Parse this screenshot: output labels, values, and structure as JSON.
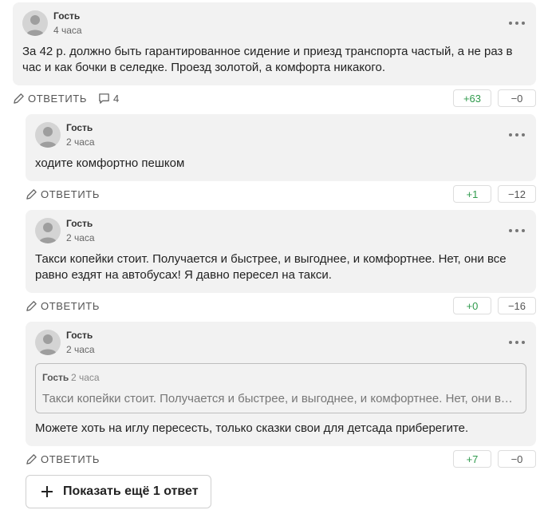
{
  "comments": [
    {
      "author": "Гость",
      "time": "4 часа",
      "text": "За 42 р. должно быть гарантированное сидение и приезд транспорта частый, а не раз в час и как бочки в селедке. Проезд золотой, а комфорта никакого.",
      "reply_label": "ОТВЕТИТЬ",
      "replies_count": "4",
      "upvotes": "+63",
      "downvotes": "−0"
    },
    {
      "author": "Гость",
      "time": "2 часа",
      "text": "ходите комфортно пешком",
      "reply_label": "ОТВЕТИТЬ",
      "upvotes": "+1",
      "downvotes": "−12"
    },
    {
      "author": "Гость",
      "time": "2 часа",
      "text": "Такси копейки стоит. Получается и быстрее, и выгоднее, и комфортнее. Нет, они все равно ездят на автобусах! Я давно пересел на такси.",
      "reply_label": "ОТВЕТИТЬ",
      "upvotes": "+0",
      "downvotes": "−16"
    },
    {
      "author": "Гость",
      "time": "2 часа",
      "quote": {
        "author": "Гость",
        "time": "2 часа",
        "text": "Такси копейки стоит. Получается и быстрее, и выгоднее, и комфортнее. Нет, они все равно ездят на автобусах! Я давно пересел на такси."
      },
      "text": "Можете хоть на иглу пересесть, только сказки свои для детсада приберегите.",
      "reply_label": "ОТВЕТИТЬ",
      "upvotes": "+7",
      "downvotes": "−0"
    }
  ],
  "show_more_label": "Показать ещё 1 ответ",
  "icons": {
    "reply": "pencil-icon",
    "replies": "comment-icon",
    "more": "more-dots-icon",
    "show_more": "plus-icon"
  },
  "colors": {
    "card_bg": "#f2f2f2",
    "upvote": "#2f9a4c",
    "avatar": "#d4d4d4"
  }
}
